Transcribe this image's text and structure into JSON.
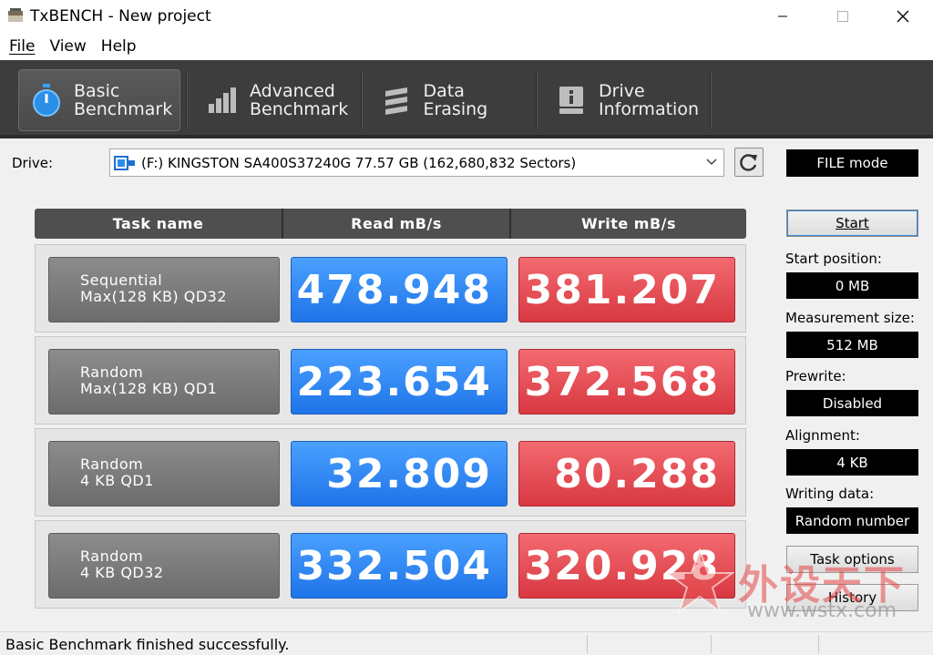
{
  "window": {
    "title": "TxBENCH - New project"
  },
  "menu": [
    {
      "label": "File"
    },
    {
      "label": "View"
    },
    {
      "label": "Help"
    }
  ],
  "toolbar": {
    "tabs": [
      {
        "line1": "Basic",
        "line2": "Benchmark",
        "icon": "stopwatch-icon",
        "active": true
      },
      {
        "line1": "Advanced",
        "line2": "Benchmark",
        "icon": "bar-chart-icon",
        "active": false
      },
      {
        "line1": "Data Erasing",
        "line2": "",
        "icon": "eraser-icon",
        "active": false
      },
      {
        "line1": "Drive",
        "line2": "Information",
        "icon": "drive-info-icon",
        "active": false
      }
    ]
  },
  "drive": {
    "label": "Drive:",
    "selected": "(F:) KINGSTON SA400S37240G  77.57 GB (162,680,832 Sectors)"
  },
  "table": {
    "headers": {
      "task": "Task name",
      "read": "Read mB/s",
      "write": "Write mB/s"
    },
    "rows": [
      {
        "task_line1": "Sequential",
        "task_line2": "Max(128 KB) QD32",
        "read": "478.948",
        "write": "381.207"
      },
      {
        "task_line1": "Random",
        "task_line2": "Max(128 KB) QD1",
        "read": "223.654",
        "write": "372.568"
      },
      {
        "task_line1": "Random",
        "task_line2": "4 KB QD1",
        "read": "32.809",
        "write": "80.288"
      },
      {
        "task_line1": "Random",
        "task_line2": "4 KB QD32",
        "read": "332.504",
        "write": "320.928"
      }
    ]
  },
  "panel": {
    "mode": "FILE mode",
    "start_label": "Start",
    "start_position_label": "Start position:",
    "start_position_value": "0 MB",
    "measurement_size_label": "Measurement size:",
    "measurement_size_value": "512 MB",
    "prewrite_label": "Prewrite:",
    "prewrite_value": "Disabled",
    "alignment_label": "Alignment:",
    "alignment_value": "4 KB",
    "writing_data_label": "Writing data:",
    "writing_data_value": "Random number",
    "task_options_label": "Task options",
    "history_label": "History"
  },
  "status": {
    "message": "Basic Benchmark finished successfully."
  },
  "watermark": {
    "text_cn": "外设天下",
    "url": "www.wstx.com"
  },
  "colors": {
    "read": "#2f86f2",
    "write": "#e84a52",
    "toolbar": "#3d3d3d"
  }
}
